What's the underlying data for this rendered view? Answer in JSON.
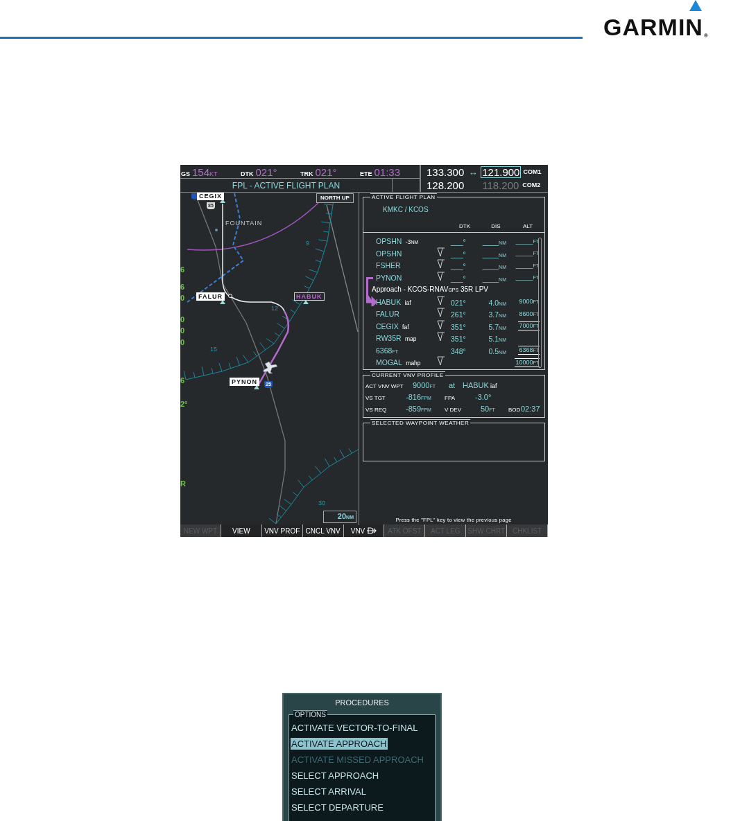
{
  "logo": {
    "text": "GARMIN",
    "mark": "®"
  },
  "mfd": {
    "top_fields": [
      {
        "label": "GS",
        "value": "154",
        "unit": "KT"
      },
      {
        "label": "DTK",
        "value": "021°"
      },
      {
        "label": "TRK",
        "value": "021°"
      },
      {
        "label": "ETE",
        "value": "01:33"
      }
    ],
    "page_title": "FPL - ACTIVE FLIGHT PLAN",
    "com": [
      {
        "active": "133.300",
        "swap": "↔",
        "standby": "121.900",
        "standby_selected": true,
        "standby_dim": false,
        "label": "COM1"
      },
      {
        "active": "128.200",
        "standby": "118.200",
        "standby_selected": false,
        "standby_dim": true,
        "label": "COM2"
      }
    ],
    "map": {
      "orientation": "NORTH UP",
      "range": "20",
      "range_unit": "NM",
      "city": "FOUNTAIN",
      "waypoints": [
        {
          "name": "CEGIX",
          "active": false
        },
        {
          "name": "FALUR",
          "active": false
        },
        {
          "name": "HABUK",
          "active": true
        },
        {
          "name": "PYNON",
          "active": false
        }
      ],
      "ring_labels": [
        "9",
        "12",
        "15",
        "30"
      ],
      "highway_shields": [
        "25",
        "85"
      ],
      "edge_digits": [
        "6",
        "6",
        "0",
        "0",
        "0",
        "0",
        "6",
        "2°",
        "R"
      ]
    },
    "flight_plan": {
      "title": "ACTIVE FLIGHT PLAN",
      "route": "KMKC / KCOS",
      "columns": [
        "DTK",
        "DIS",
        "ALT"
      ],
      "rows": [
        {
          "kind": "waypoint",
          "name": "OPSHN",
          "tag": "-3",
          "tag_unit": "NM",
          "vnav_icon": false,
          "dtk": "___°",
          "dis": "____",
          "dis_unit": "NM",
          "alt": "_____",
          "alt_unit": "FT",
          "constraint": false,
          "leg_start": false,
          "leg_end": false
        },
        {
          "kind": "waypoint",
          "name": "OPSHN",
          "vnav_icon": true,
          "dtk": "___°",
          "dis": "____",
          "dis_unit": "NM",
          "alt": "_____",
          "alt_unit": "FT",
          "constraint": false,
          "leg_start": false,
          "leg_end": false
        },
        {
          "kind": "waypoint",
          "name": "FSHER",
          "vnav_icon": true,
          "dtk": "___°",
          "dis": "____",
          "dis_unit": "NM",
          "alt": "_____",
          "alt_unit": "FT",
          "constraint": false,
          "leg_start": false,
          "leg_end": false
        },
        {
          "kind": "waypoint",
          "name": "PYNON",
          "vnav_icon": true,
          "dtk": "___°",
          "dis": "____",
          "dis_unit": "NM",
          "alt": "_____",
          "alt_unit": "FT",
          "constraint": false,
          "leg_start": true,
          "leg_end": false
        },
        {
          "kind": "header",
          "text": "Approach - KCOS-RNAV",
          "sub": "GPS",
          "rest": "35R LPV"
        },
        {
          "kind": "waypoint",
          "name": "HABUK",
          "tag": "iaf",
          "vnav_icon": true,
          "dtk": "021°",
          "dis": "4.0",
          "dis_unit": "NM",
          "alt": "9000",
          "alt_unit": "FT",
          "constraint": false,
          "leg_start": false,
          "leg_end": true
        },
        {
          "kind": "waypoint",
          "name": "FALUR",
          "vnav_icon": true,
          "dtk": "261°",
          "dis": "3.7",
          "dis_unit": "NM",
          "alt": "8600",
          "alt_unit": "FT",
          "constraint": false,
          "leg_start": false,
          "leg_end": false
        },
        {
          "kind": "waypoint",
          "name": "CEGIX",
          "tag": "faf",
          "vnav_icon": true,
          "dtk": "351°",
          "dis": "5.7",
          "dis_unit": "NM",
          "alt": "7000",
          "alt_unit": "FT",
          "constraint": true,
          "leg_start": false,
          "leg_end": false
        },
        {
          "kind": "waypoint",
          "name": "RW35R",
          "tag": "map",
          "vnav_icon": true,
          "dtk": "351°",
          "dis": "5.1",
          "dis_unit": "NM",
          "leg_start": false,
          "leg_end": false
        },
        {
          "kind": "waypoint",
          "name": "6368",
          "name_unit": "FT",
          "vnav_icon": false,
          "dtk": "348°",
          "dis": "0.5",
          "dis_unit": "NM",
          "alt": "6368",
          "alt_unit": "FT",
          "constraint": true,
          "leg_start": false,
          "leg_end": false
        },
        {
          "kind": "waypoint",
          "name": "MOGAL",
          "tag": "mahp",
          "vnav_icon": true,
          "alt": "10000",
          "alt_unit": "FT",
          "constraint": true,
          "leg_start": false,
          "leg_end": false
        }
      ]
    },
    "vnv_profile": {
      "title": "CURRENT VNV PROFILE",
      "lines": [
        [
          {
            "kind": "label",
            "text": "ACT VNV WPT"
          },
          {
            "kind": "value",
            "text": "9000",
            "unit": "FT"
          },
          {
            "kind": "value",
            "text": "at"
          },
          {
            "kind": "value",
            "text": "HABUK"
          },
          {
            "kind": "tag",
            "text": "iaf"
          }
        ],
        [
          {
            "kind": "label",
            "text": "VS TGT"
          },
          {
            "kind": "value",
            "text": "-816",
            "unit": "FPM"
          },
          {
            "kind": "label",
            "text": "FPA"
          },
          {
            "kind": "value",
            "text": "-3.0°"
          }
        ],
        [
          {
            "kind": "label",
            "text": "VS REQ"
          },
          {
            "kind": "value",
            "text": "-859",
            "unit": "FPM"
          },
          {
            "kind": "label",
            "text": "V DEV"
          },
          {
            "kind": "value",
            "text": "50",
            "unit": "FT"
          },
          {
            "kind": "label",
            "text": "BOD"
          },
          {
            "kind": "value",
            "text": "02:37"
          }
        ]
      ]
    },
    "weather": {
      "title": "SELECTED WAYPOINT WEATHER"
    },
    "message": "Press the \"FPL\" key to view the previous page",
    "softkeys": [
      {
        "kind": "plain",
        "label": "NEW WPT",
        "disabled": true
      },
      {
        "kind": "plain",
        "label": "VIEW",
        "disabled": false
      },
      {
        "kind": "plain",
        "label": "VNV PROF",
        "disabled": false
      },
      {
        "kind": "plain",
        "label": "CNCL VNV",
        "disabled": false
      },
      {
        "kind": "direct",
        "label": "VNV",
        "disabled": false
      },
      {
        "kind": "plain",
        "label": "ATK OFST",
        "disabled": true
      },
      {
        "kind": "plain",
        "label": "ACT LEG",
        "disabled": true
      },
      {
        "kind": "plain",
        "label": "SHW CHRT",
        "disabled": true
      },
      {
        "kind": "plain",
        "label": "CHKLIST",
        "disabled": true
      }
    ]
  },
  "procedures": {
    "title": "PROCEDURES",
    "group": "OPTIONS",
    "items": [
      {
        "label": "ACTIVATE VECTOR-TO-FINAL",
        "selected": false,
        "disabled": false
      },
      {
        "label": "ACTIVATE APPROACH",
        "selected": true,
        "disabled": false
      },
      {
        "label": "ACTIVATE MISSED APPROACH",
        "selected": false,
        "disabled": true
      },
      {
        "label": "SELECT APPROACH",
        "selected": false,
        "disabled": false
      },
      {
        "label": "SELECT ARRIVAL",
        "selected": false,
        "disabled": false
      },
      {
        "label": "SELECT DEPARTURE",
        "selected": false,
        "disabled": false
      }
    ]
  }
}
